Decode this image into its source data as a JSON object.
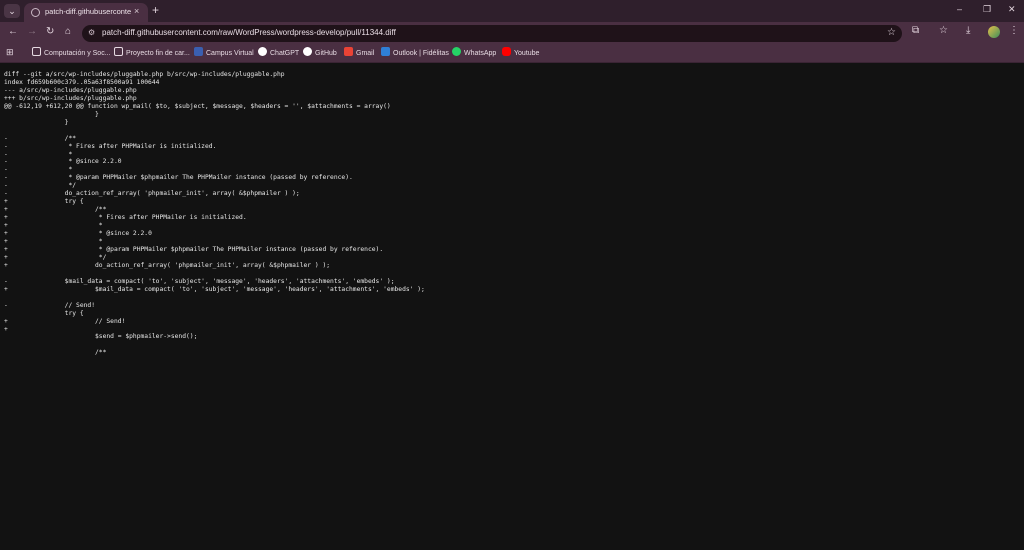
{
  "browser": {
    "tab_menu_icon": "chevron-down-icon",
    "tab": {
      "title": "patch-diff.githubusercontent.co",
      "close_glyph": "×"
    },
    "new_tab_glyph": "+",
    "window_controls": {
      "minimize": "–",
      "maximize": "❐",
      "close": "✕"
    },
    "nav": {
      "back": "←",
      "forward": "→",
      "reload": "↻",
      "home": "⌂"
    },
    "omnibox": {
      "url": "patch-diff.githubusercontent.com/raw/WordPress/wordpress-develop/pull/11344.diff"
    },
    "bookmarks": [
      {
        "label": "Computación y Soc...",
        "icon": "folder-icon",
        "color": "#e7dbe3"
      },
      {
        "label": "Proyecto fin de car...",
        "icon": "folder-icon",
        "color": "#e7dbe3"
      },
      {
        "label": "Campus Virtual",
        "icon": "campus-icon",
        "color": "#3a5fb0"
      },
      {
        "label": "ChatGPT",
        "icon": "chatgpt-icon",
        "color": "#ffffff"
      },
      {
        "label": "GitHub",
        "icon": "github-icon",
        "color": "#ffffff"
      },
      {
        "label": "Gmail",
        "icon": "gmail-icon",
        "color": "#ea4335"
      },
      {
        "label": "Outlook | Fidélitas",
        "icon": "outlook-icon",
        "color": "#2f7fd6"
      },
      {
        "label": "WhatsApp",
        "icon": "whatsapp-icon",
        "color": "#25d366"
      },
      {
        "label": "Youtube",
        "icon": "youtube-icon",
        "color": "#ff0000"
      }
    ]
  },
  "diff": {
    "lines": [
      "diff --git a/src/wp-includes/pluggable.php b/src/wp-includes/pluggable.php",
      "index fd659b600c379..05a63f8500a91 100644",
      "--- a/src/wp-includes/pluggable.php",
      "+++ b/src/wp-includes/pluggable.php",
      "@@ -612,19 +612,20 @@ function wp_mail( $to, $subject, $message, $headers = '', $attachments = array()",
      " \t\t\t}",
      " \t\t}",
      " ",
      "-\t\t/**",
      "-\t\t * Fires after PHPMailer is initialized.",
      "-\t\t *",
      "-\t\t * @since 2.2.0",
      "-\t\t *",
      "-\t\t * @param PHPMailer $phpmailer The PHPMailer instance (passed by reference).",
      "-\t\t */",
      "-\t\tdo_action_ref_array( 'phpmailer_init', array( &$phpmailer ) );",
      "+\t\ttry {",
      "+\t\t\t/**",
      "+\t\t\t * Fires after PHPMailer is initialized.",
      "+\t\t\t *",
      "+\t\t\t * @since 2.2.0",
      "+\t\t\t *",
      "+\t\t\t * @param PHPMailer $phpmailer The PHPMailer instance (passed by reference).",
      "+\t\t\t */",
      "+\t\t\tdo_action_ref_array( 'phpmailer_init', array( &$phpmailer ) );",
      " ",
      "-\t\t$mail_data = compact( 'to', 'subject', 'message', 'headers', 'attachments', 'embeds' );",
      "+\t\t\t$mail_data = compact( 'to', 'subject', 'message', 'headers', 'attachments', 'embeds' );",
      " ",
      "-\t\t// Send!",
      " \t\ttry {",
      "+\t\t\t// Send!",
      "+",
      " \t\t\t$send = $phpmailer->send();",
      " ",
      " \t\t\t/**"
    ]
  }
}
